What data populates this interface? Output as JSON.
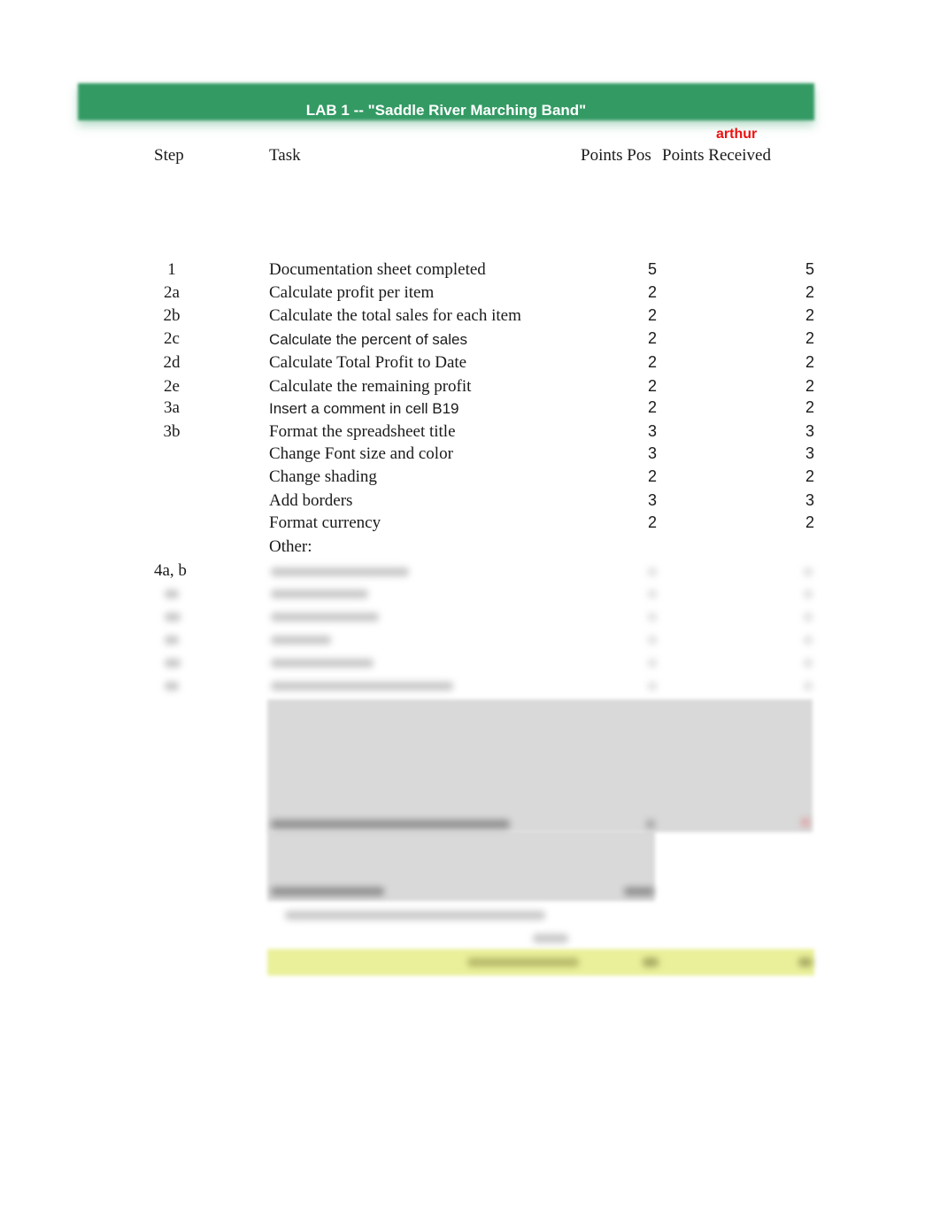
{
  "header": {
    "title": "LAB 1 -- \"Saddle River Marching Band\"",
    "grader_name": "arthur",
    "title_bar_color": "#339a64",
    "grader_color": "#ee1111"
  },
  "columns": {
    "step": "Step",
    "task": "Task",
    "points_possible": "Points Pos",
    "points_received": "Points Received"
  },
  "rows": [
    {
      "step": "1",
      "task": "Documentation sheet completed",
      "pos": "5",
      "rec": "5"
    },
    {
      "step": "2a",
      "task": "Calculate profit per item",
      "pos": "2",
      "rec": "2"
    },
    {
      "step": "2b",
      "task": "Calculate the total sales for each item",
      "pos": "2",
      "rec": "2"
    },
    {
      "step": "2c",
      "task": "Calculate the percent of sales",
      "pos": "2",
      "rec": "2"
    },
    {
      "step": "2d",
      "task": "Calculate Total Profit to Date",
      "pos": "2",
      "rec": "2"
    },
    {
      "step": "2e",
      "task": "Calculate the remaining profit",
      "pos": "2",
      "rec": "2"
    },
    {
      "step": "3a",
      "task": "Insert a comment in cell B19",
      "pos": "2",
      "rec": "2"
    },
    {
      "step": "3b",
      "task": "Format the spreadsheet  title",
      "pos": "3",
      "rec": "3"
    },
    {
      "step": "",
      "task": "Change Font size and color",
      "pos": "3",
      "rec": "3"
    },
    {
      "step": "",
      "task": "Change shading",
      "pos": "2",
      "rec": "2"
    },
    {
      "step": "",
      "task": "Add borders",
      "pos": "3",
      "rec": "3"
    },
    {
      "step": "",
      "task": "Format currency",
      "pos": "2",
      "rec": "2"
    },
    {
      "step": "",
      "task": "Other:",
      "pos": "",
      "rec": ""
    },
    {
      "step": "4a, b",
      "task": "",
      "pos": "",
      "rec": ""
    }
  ],
  "blurred_section": {
    "note": "",
    "highlight_color": "#eaf09a",
    "shade_color": "#d9d9d9"
  }
}
